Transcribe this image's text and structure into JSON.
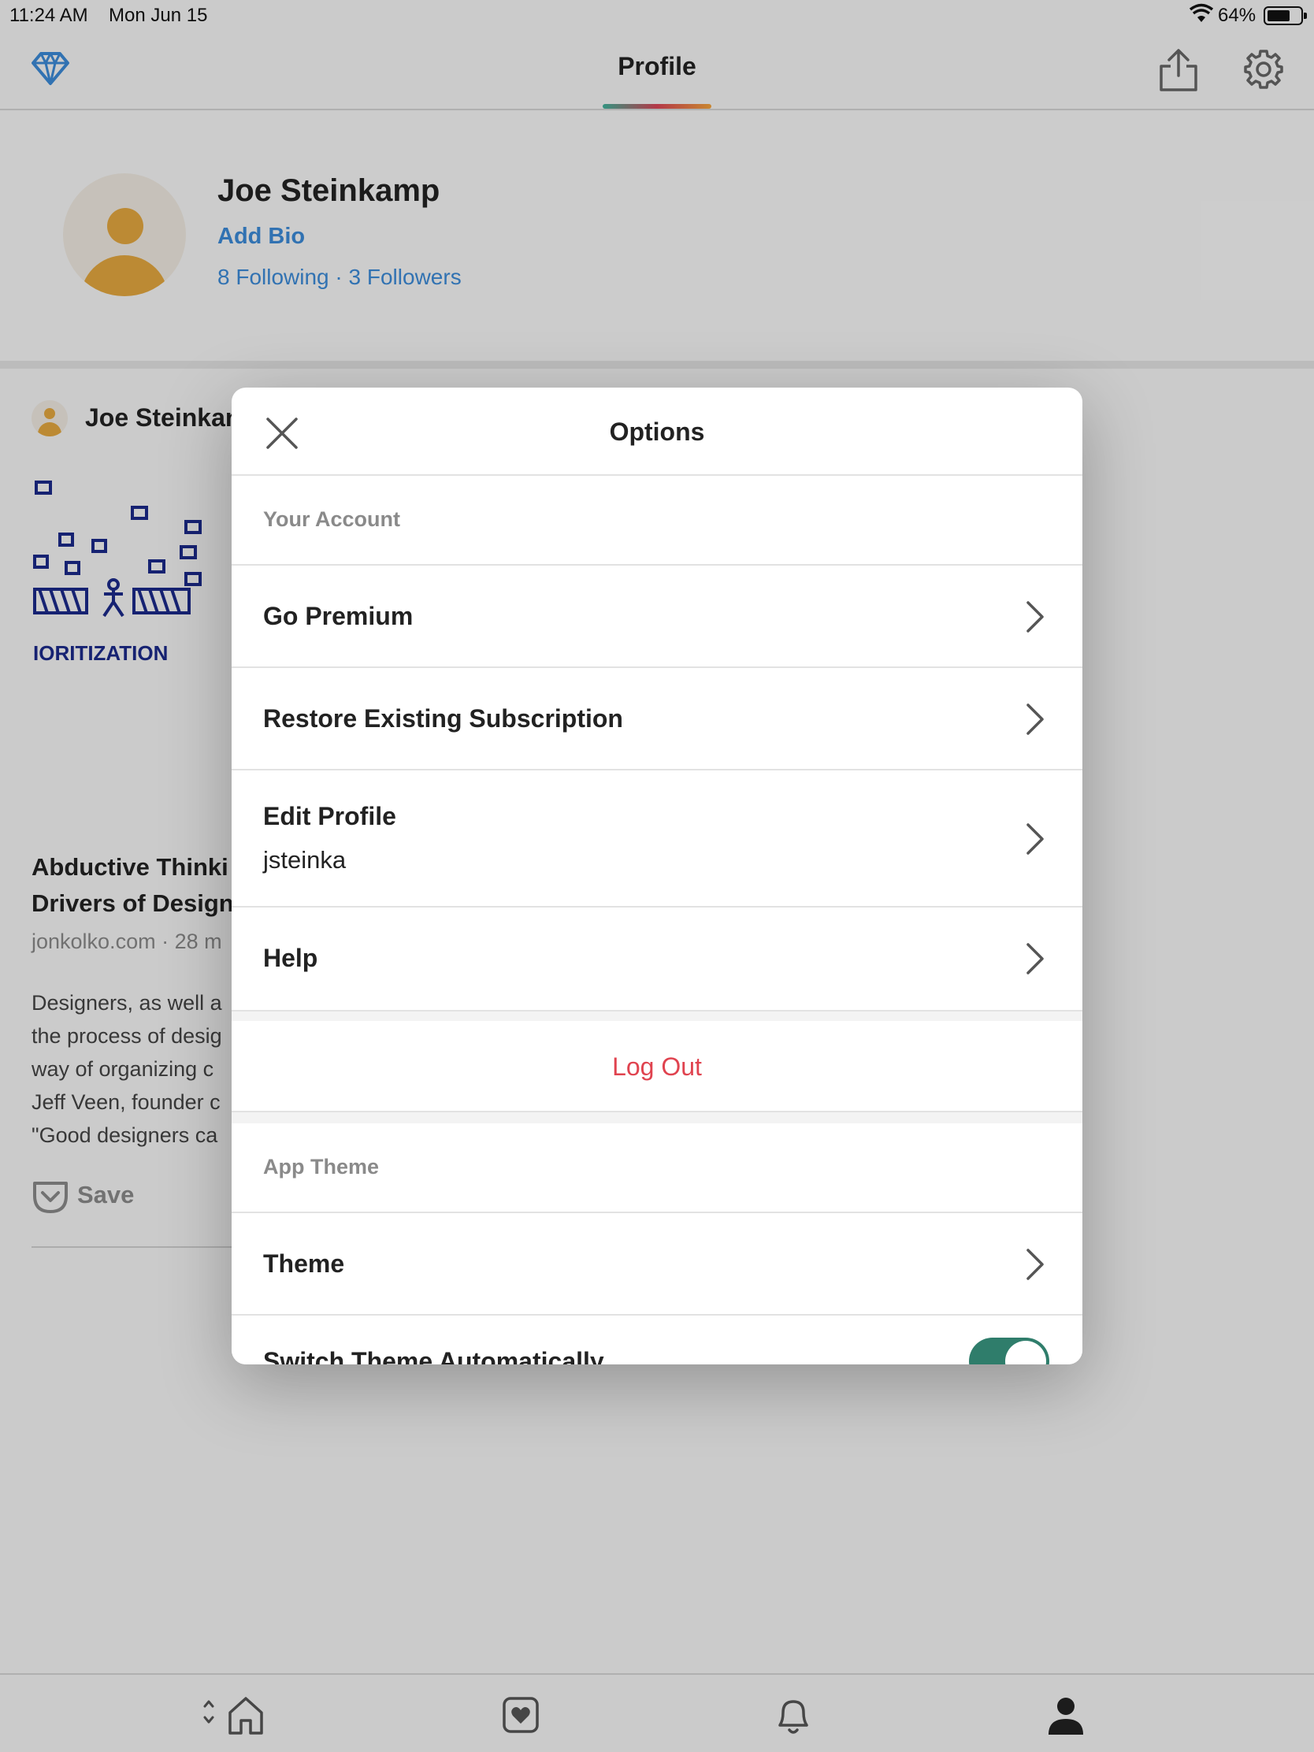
{
  "status_bar": {
    "time": "11:24 AM",
    "date": "Mon Jun 15",
    "battery": "64%"
  },
  "top_bar": {
    "title": "Profile"
  },
  "profile": {
    "name": "Joe Steinkamp",
    "add_bio": "Add Bio",
    "following": "8 Following",
    "separator": "·",
    "followers": "3 Followers"
  },
  "feed_item": {
    "author": "Joe Steinkan",
    "title": "Abductive Thinki\nDrivers of Design",
    "meta": "jonkolko.com · 28 m",
    "excerpt": "Designers, as well a\nthe process of desig\nway of organizing c\nJeff Veen, founder c\n\"Good designers ca",
    "save_label": "Save",
    "thumbnail_text": "IORITIZATION"
  },
  "modal": {
    "title": "Options",
    "sections": {
      "account_label": "Your Account",
      "theme_label": "App Theme"
    },
    "items": {
      "go_premium": "Go Premium",
      "restore": "Restore Existing Subscription",
      "edit_profile": "Edit Profile",
      "username": "jsteinka",
      "help": "Help",
      "log_out": "Log Out",
      "theme": "Theme",
      "switch_theme": "Switch Theme Automatically"
    },
    "switch_theme_enabled": true
  },
  "colors": {
    "link_blue": "#3b8ad6",
    "logout_red": "#e0434f",
    "toggle_green": "#2f7d6b",
    "avatar_gold": "#e2a73f"
  },
  "icons": {
    "premium": "diamond-icon",
    "share": "share-icon",
    "settings": "gear-icon",
    "close": "close-icon",
    "chevron": "chevron-right-icon",
    "tabs": [
      "home-icon",
      "saves-icon",
      "bell-icon",
      "profile-icon"
    ]
  }
}
